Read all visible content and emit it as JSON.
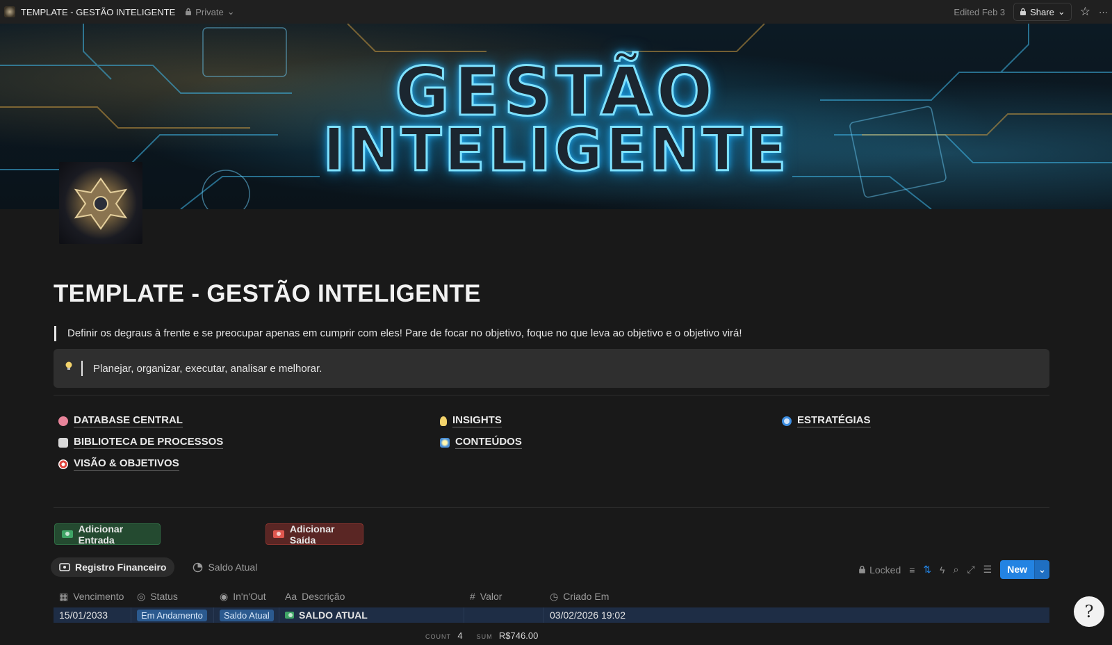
{
  "topbar": {
    "title": "TEMPLATE - GESTÃO INTELIGENTE",
    "privacy": "Private",
    "edited": "Edited Feb 3",
    "share": "Share"
  },
  "banner": {
    "line1": "GESTÃO",
    "line2": "INTELIGENTE"
  },
  "page": {
    "title": "TEMPLATE - GESTÃO INTELIGENTE",
    "quote": "Definir os degraus à frente e se preocupar apenas em cumprir com eles! Pare de focar no objetivo, foque no que leva ao objetivo e o objetivo virá!",
    "callout": "Planejar, organizar, executar, analisar e melhorar."
  },
  "links": {
    "database": "DATABASE CENTRAL",
    "biblioteca": "BIBLIOTECA DE PROCESSOS",
    "visao": "VISÃO & OBJETIVOS",
    "insights": "INSIGHTS",
    "conteudos": "CONTEÚDOS",
    "estrategias": "ESTRATÉGIAS"
  },
  "buttons": {
    "entrada": "Adicionar Entrada",
    "saida": "Adicionar Saída"
  },
  "views": {
    "registro": "Registro Financeiro",
    "saldo": "Saldo Atual"
  },
  "toolbar": {
    "locked": "Locked",
    "new": "New"
  },
  "table": {
    "headers": {
      "vencimento": "Vencimento",
      "status": "Status",
      "inout": "In'n'Out",
      "descricao": "Descrição",
      "valor": "Valor",
      "criado": "Criado Em"
    },
    "rows": [
      {
        "vencimento": "15/01/2033",
        "status": "Em Andamento",
        "inout": "Saldo Atual",
        "descricao": "SALDO ATUAL",
        "valor": "",
        "criado": "03/02/2026 19:02"
      }
    ]
  },
  "footer": {
    "count_label": "COUNT",
    "count_value": "4",
    "sum_label": "SUM",
    "sum_value": "R$746.00"
  },
  "colors": {
    "accent": "#2383e2",
    "entrada_bg": "#244a30",
    "saida_bg": "#5a2624",
    "row_highlight": "#1e2d45"
  }
}
